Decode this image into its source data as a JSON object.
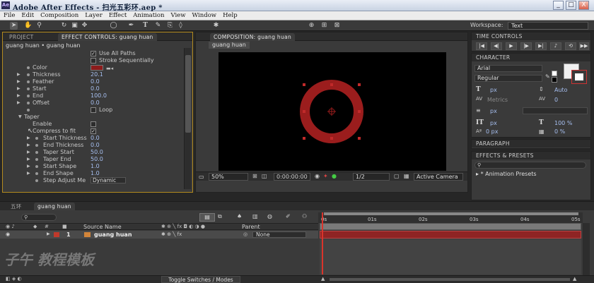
{
  "app": {
    "title": "Adobe After Effects - 扫光五彩环.aep *",
    "window_min": "_",
    "window_max": "□",
    "window_close": "X"
  },
  "menu": [
    "File",
    "Edit",
    "Composition",
    "Layer",
    "Effect",
    "Animation",
    "View",
    "Window",
    "Help"
  ],
  "toolbar": {
    "workspace_label": "Workspace:",
    "workspace_value": "Text"
  },
  "fx_panel": {
    "tab_project": "PROJECT",
    "tab_fx": "EFFECT CONTROLS: guang huan",
    "breadcrumb": "guang huan • guang huan",
    "use_all_paths": "Use All Paths",
    "stroke_seq": "Stroke Sequentially",
    "color_label": "Color",
    "thickness_label": "Thickness",
    "thickness_val": "20.1",
    "feather_label": "Feather",
    "feather_val": "0.0",
    "start_label": "Start",
    "start_val": "0.0",
    "end_label": "End",
    "end_val": "100.0",
    "offset_label": "Offset",
    "offset_val": "0.0",
    "loop_label": "Loop",
    "taper_label": "Taper",
    "enable_label": "Enable",
    "compress_label": "Compress to fit",
    "start_thick_label": "Start Thickness",
    "start_thick_val": "0.0",
    "end_thick_label": "End Thickness",
    "end_thick_val": "0.0",
    "taper_start_label": "Taper Start",
    "taper_start_val": "50.0",
    "taper_end_label": "Taper End",
    "taper_end_val": "50.0",
    "start_shape_label": "Start Shape",
    "start_shape_val": "1.0",
    "end_shape_label": "End Shape",
    "end_shape_val": "1.0",
    "step_adjust_label": "Step Adjust Me",
    "step_adjust_val": "Dynamic",
    "color_swatch": "#8c1b1b"
  },
  "comp_panel": {
    "tab": "COMPOSITION: guang huan",
    "subtab": "guang huan",
    "zoom": "50%",
    "timecode": "0:00:00:00",
    "resolution": "1/2",
    "camera": "Active Camera",
    "ring_color": "#9b1d1d"
  },
  "right": {
    "time_controls": "TIME CONTROLS",
    "character": "CHARACTER",
    "font": "Arial",
    "style": "Regular",
    "size_unit": "px",
    "leading": "Auto",
    "metrics": "Metrics",
    "tracking": "0",
    "stroke_unit": "px",
    "vert_scale": "100 %",
    "baseline": "0 px",
    "tsume": "0 %",
    "paragraph": "PARAGRAPH",
    "effects_presets": "EFFECTS & PRESETS",
    "search_placeholder": "",
    "animation_presets": "* Animation Presets"
  },
  "timeline": {
    "tab_comp1": "五环",
    "tab_comp2": "guang huan",
    "col_source": "Source Name",
    "col_parent": "Parent",
    "layer_index": "1",
    "layer_name": "guang huan",
    "parent_value": "None",
    "ticks": [
      "0s",
      "01s",
      "02s",
      "03s",
      "04s",
      "05s"
    ],
    "toggle_label": "Toggle Switches / Modes",
    "watermark": "子午 教程模板"
  }
}
